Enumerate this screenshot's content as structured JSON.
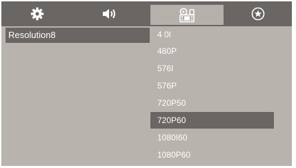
{
  "tabs": [
    {
      "icon": "gear-icon"
    },
    {
      "icon": "speaker-icon"
    },
    {
      "icon": "film-icon",
      "active": true
    },
    {
      "icon": "star-circle-icon"
    }
  ],
  "category": {
    "label": "Resolution8"
  },
  "options": [
    {
      "label": "4 0I"
    },
    {
      "label": "480P"
    },
    {
      "label": "576I"
    },
    {
      "label": "576P"
    },
    {
      "label": "720P50"
    },
    {
      "label": "720P60",
      "selected": true
    },
    {
      "label": "1080I60"
    },
    {
      "label": "1080P60"
    }
  ],
  "colors": {
    "panel": "#b8b3ad",
    "tabbar": "#6a6664",
    "active_tab": "#b5b0aa",
    "highlight": "#6a6664",
    "text": "#ffffff"
  }
}
